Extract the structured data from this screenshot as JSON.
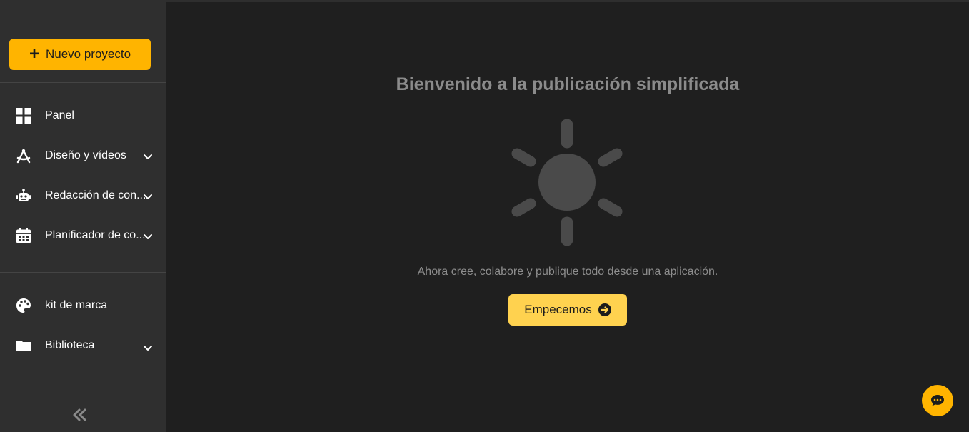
{
  "sidebar": {
    "new_project": {
      "label": "Nuevo proyecto",
      "icon": "plus-icon"
    },
    "items": [
      {
        "label": "Panel",
        "icon": "dashboard-icon",
        "has_submenu": false
      },
      {
        "label": "Diseño y vídeos",
        "icon": "compass-pen-icon",
        "has_submenu": true
      },
      {
        "label": "Redacción de con...",
        "icon": "robot-icon",
        "has_submenu": true
      },
      {
        "label": "Planificador de co...",
        "icon": "calendar-icon",
        "has_submenu": true
      },
      {
        "label": "kit de marca",
        "icon": "palette-icon",
        "has_submenu": false
      },
      {
        "label": "Biblioteca",
        "icon": "folder-icon",
        "has_submenu": true
      }
    ],
    "collapse_icon": "double-chevron-left-icon"
  },
  "main": {
    "title": "Bienvenido a la publicación simplificada",
    "illustration_icon": "sun-icon",
    "subtitle": "Ahora cree, colabore y publique todo desde una aplicación.",
    "start_button": {
      "label": "Empecemos",
      "icon": "arrow-circle-right-icon"
    }
  },
  "chat": {
    "icon": "chat-bubble-icon"
  },
  "colors": {
    "accent": "#ffb400",
    "start_button": "#ffd24f",
    "sidebar_bg": "#2f2f2f",
    "main_bg": "#1f1f1f",
    "muted_text": "#8b8b8b",
    "illustration": "#4a4a4a"
  }
}
